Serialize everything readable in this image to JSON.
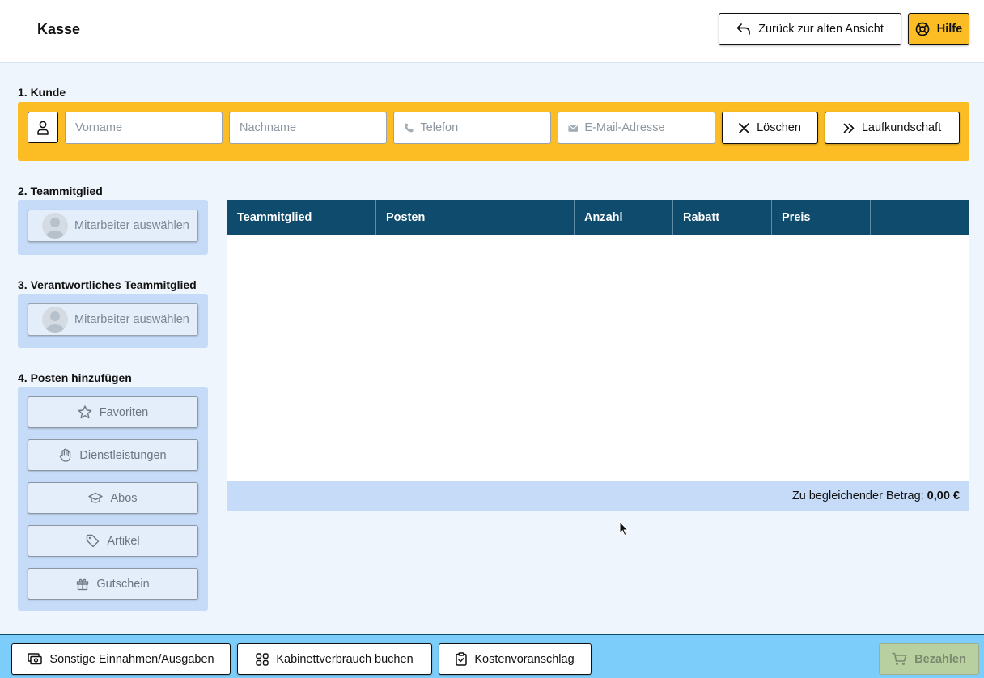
{
  "header": {
    "title": "Kasse",
    "back_button": "Zurück zur alten Ansicht",
    "help_button": "Hilfe"
  },
  "customer": {
    "section_label": "1. Kunde",
    "first_name_placeholder": "Vorname",
    "last_name_placeholder": "Nachname",
    "phone_placeholder": "Telefon",
    "email_placeholder": "E-Mail-Adresse",
    "clear_button": "Löschen",
    "walkin_button": "Laufkundschaft"
  },
  "team_member": {
    "section_label": "2. Teammitglied",
    "select_label": "Mitarbeiter auswählen"
  },
  "responsible_member": {
    "section_label": "3. Verantwortliches Teammitglied",
    "select_label": "Mitarbeiter auswählen"
  },
  "add_items": {
    "section_label": "4. Posten hinzufügen",
    "buttons": [
      {
        "label": "Favoriten",
        "icon": "star-icon"
      },
      {
        "label": "Dienstleistungen",
        "icon": "hand-icon"
      },
      {
        "label": "Abos",
        "icon": "graduation-cap-icon"
      },
      {
        "label": "Artikel",
        "icon": "tag-icon"
      },
      {
        "label": "Gutschein",
        "icon": "gift-icon"
      }
    ]
  },
  "table": {
    "columns": [
      "Teammitglied",
      "Posten",
      "Anzahl",
      "Rabatt",
      "Preis",
      ""
    ],
    "rows": [],
    "total_label": "Zu begleichender Betrag:",
    "total_value": "0,00 €"
  },
  "footer": {
    "other_income": "Sonstige Einnahmen/Ausgaben",
    "cabinet_usage": "Kabinettverbrauch buchen",
    "estimate": "Kostenvoranschlag",
    "pay": "Bezahlen"
  },
  "colors": {
    "accent_yellow": "#fbbd23",
    "header_navy": "#0e4b6d",
    "panel_blue": "#c5dbf7",
    "footer_blue": "#7dcdfa",
    "pay_disabled": "#b8cfa0"
  }
}
